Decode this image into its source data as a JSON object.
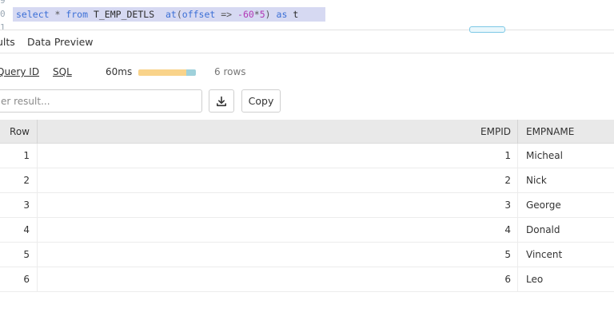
{
  "editor": {
    "line_numbers": [
      "9",
      "0",
      "1"
    ],
    "code_tokens": [
      {
        "text": "select",
        "cls": "kw"
      },
      {
        "text": " * ",
        "cls": "op"
      },
      {
        "text": "from",
        "cls": "kw"
      },
      {
        "text": " T_EMP_DETLS  ",
        "cls": ""
      },
      {
        "text": "at",
        "cls": "kw"
      },
      {
        "text": "(",
        "cls": "op"
      },
      {
        "text": "offset",
        "cls": "kw"
      },
      {
        "text": " => ",
        "cls": "op"
      },
      {
        "text": "-60",
        "cls": "num"
      },
      {
        "text": "*",
        "cls": "op"
      },
      {
        "text": "5",
        "cls": "num"
      },
      {
        "text": ") ",
        "cls": "op"
      },
      {
        "text": "as",
        "cls": "kw"
      },
      {
        "text": " t",
        "cls": ""
      }
    ]
  },
  "tabs": {
    "results": "ults",
    "preview": "Data Preview"
  },
  "stats": {
    "query_id_label": "Query ID",
    "sql_label": "SQL",
    "duration": "60ms",
    "timing_bar": [
      {
        "fraction": 0.83,
        "color": "#f9d38a"
      },
      {
        "fraction": 0.17,
        "color": "#9fd1db"
      }
    ],
    "rows_count": "6 rows"
  },
  "toolbar": {
    "filter_placeholder": "er result...",
    "copy_label": "Copy"
  },
  "icons": {
    "download": "download-icon"
  },
  "table": {
    "headers": {
      "row": "Row",
      "empid": "EMPID",
      "empname": "EMPNAME"
    },
    "rows": [
      {
        "row": "1",
        "empid": "1",
        "empname": "Micheal"
      },
      {
        "row": "2",
        "empid": "2",
        "empname": "Nick"
      },
      {
        "row": "3",
        "empid": "3",
        "empname": "George"
      },
      {
        "row": "4",
        "empid": "4",
        "empname": "Donald"
      },
      {
        "row": "5",
        "empid": "5",
        "empname": "Vincent"
      },
      {
        "row": "6",
        "empid": "6",
        "empname": "Leo"
      }
    ]
  },
  "colors": {
    "selection": "#d6d9f2",
    "keyword": "#3b6fd6",
    "number": "#b238b5",
    "header_bg": "#e9e9e9"
  }
}
